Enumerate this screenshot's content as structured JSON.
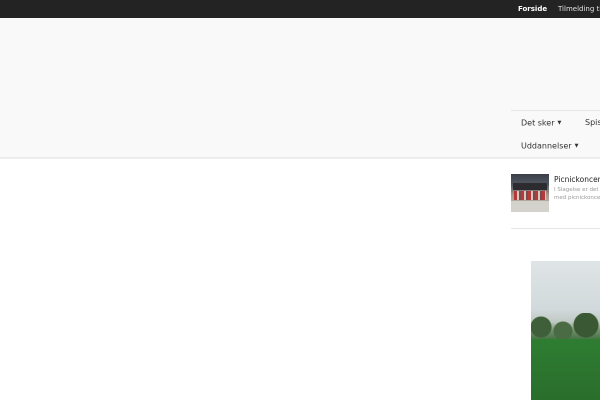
{
  "topbar": {
    "links": [
      {
        "label": "Forside",
        "active": true
      },
      {
        "label": "Tilmelding til",
        "active": false
      }
    ],
    "background": "#232323"
  },
  "nav": {
    "items": [
      {
        "label": "Det sker",
        "has_dropdown": true
      },
      {
        "label": "Spis",
        "has_dropdown": false
      },
      {
        "label": "Uddannelser",
        "has_dropdown": true
      }
    ]
  },
  "news": {
    "title": "Picnickoncert",
    "snippet_line1": "I Slagelse er det",
    "snippet_line2": "med picnickonce"
  },
  "icons": {
    "dropdown": "caret-down-icon"
  }
}
